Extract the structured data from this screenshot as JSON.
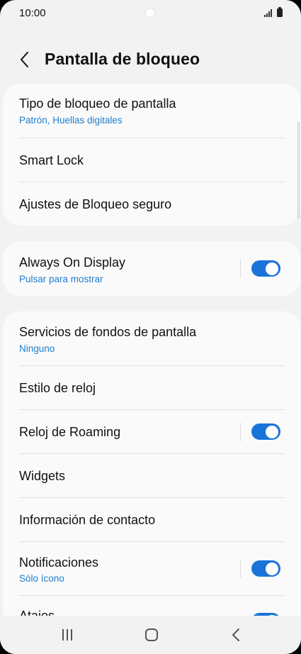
{
  "status_bar": {
    "time": "10:00",
    "icons": [
      "camera-hole",
      "signal-icon",
      "battery-icon"
    ]
  },
  "header": {
    "back_icon": "chevron-left-icon",
    "title": "Pantalla de bloqueo"
  },
  "accent_color": "#1a73d9",
  "subtitle_color": "#1f7dcf",
  "card1": {
    "items": [
      {
        "title": "Tipo de bloqueo de pantalla",
        "subtitle": "Patrón, Huellas digitales"
      },
      {
        "title": "Smart Lock"
      },
      {
        "title": "Ajustes de Bloqueo seguro"
      }
    ]
  },
  "card2": {
    "items": [
      {
        "title": "Always On Display",
        "subtitle": "Pulsar para mostrar",
        "toggle": true
      }
    ]
  },
  "card3": {
    "items": [
      {
        "title": "Servicios de fondos de pantalla",
        "subtitle": "Ninguno"
      },
      {
        "title": "Estilo de reloj"
      },
      {
        "title": "Reloj de Roaming",
        "toggle": true
      },
      {
        "title": "Widgets"
      },
      {
        "title": "Información de contacto"
      },
      {
        "title": "Notificaciones",
        "subtitle": "Sólo ícono",
        "toggle": true
      },
      {
        "title": "Atajos",
        "toggle": true
      }
    ]
  },
  "nav_bar": {
    "icons": [
      "recents-icon",
      "home-icon",
      "back-icon"
    ]
  }
}
